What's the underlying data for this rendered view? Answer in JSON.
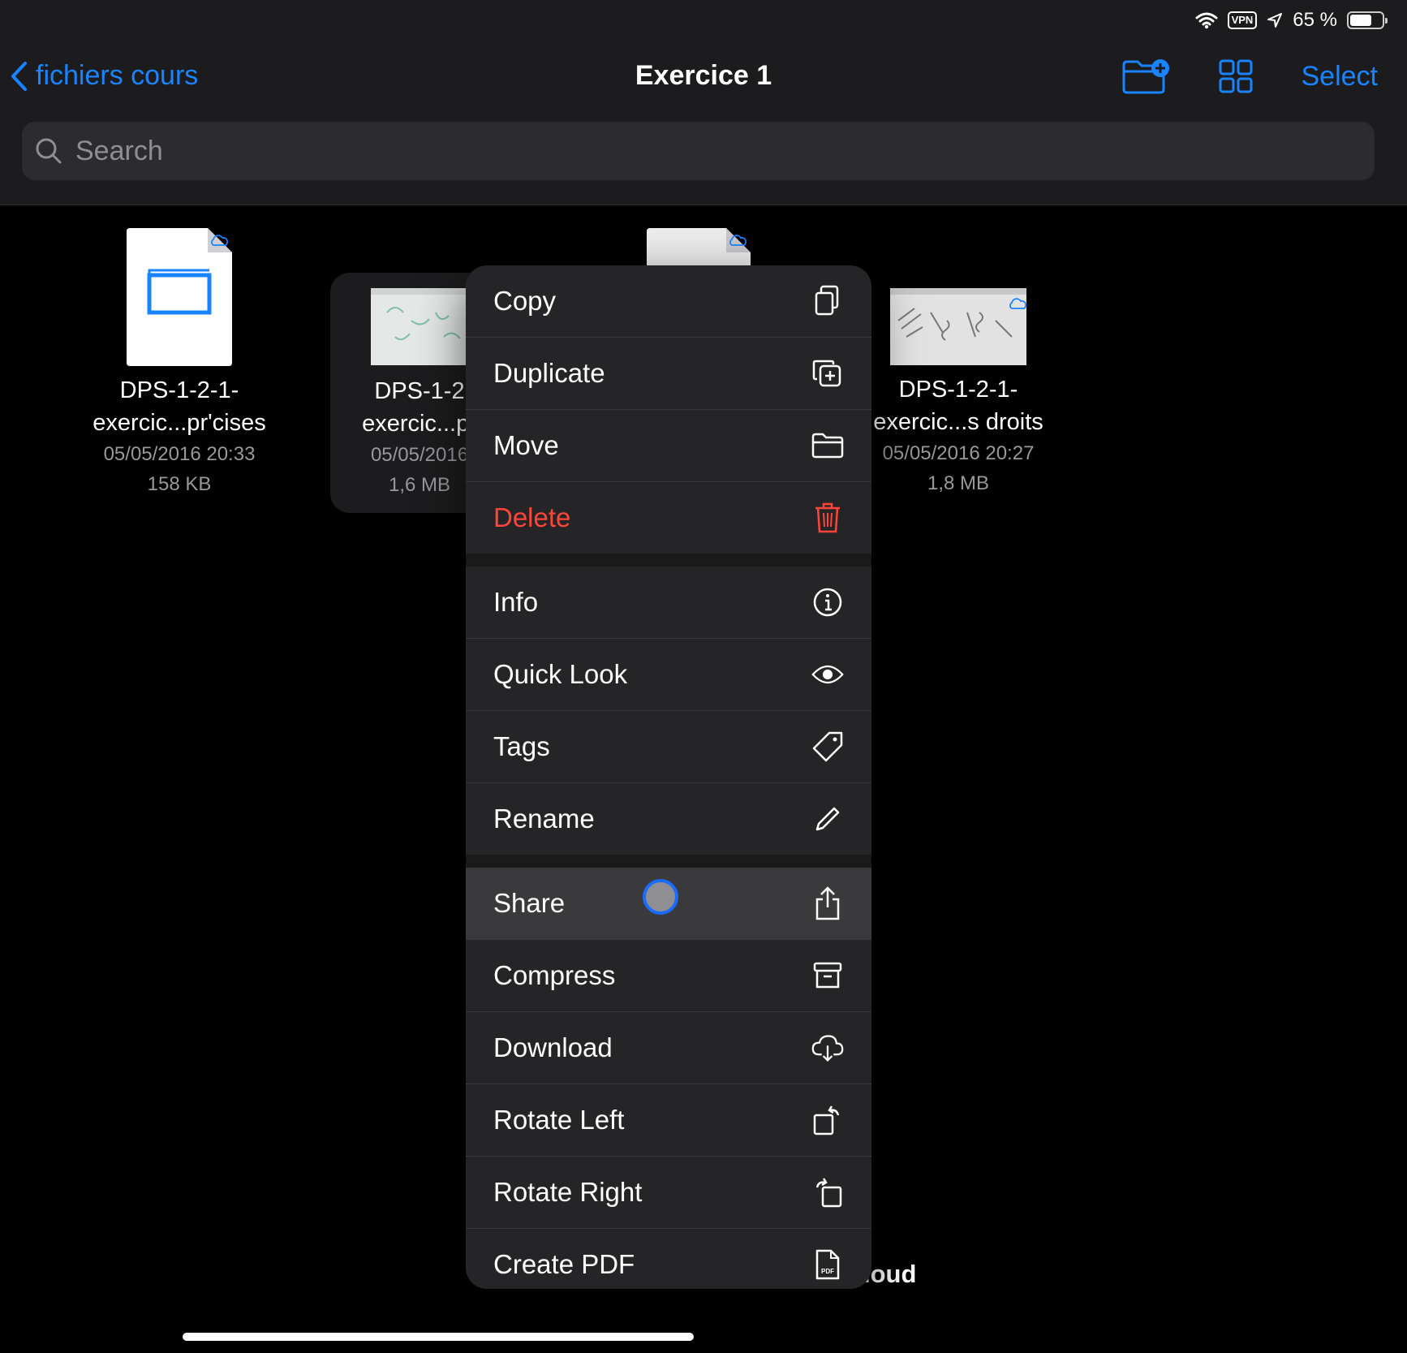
{
  "status": {
    "battery_text": "65 %",
    "vpn": "VPN",
    "battery_level": 0.65
  },
  "nav": {
    "back_label": "fichiers cours",
    "title": "Exercice 1",
    "select_label": "Select"
  },
  "search": {
    "placeholder": "Search"
  },
  "files": [
    {
      "name_line1": "DPS-1-2-1-",
      "name_line2": "exercic...pr'cises",
      "date": "05/05/2016 20:33",
      "size": "158 KB"
    },
    {
      "name_line1": "DPS-1-2",
      "name_line2": "exercic...pr",
      "date": "05/05/2016",
      "size": "1,6 MB"
    },
    {
      "name_line1": "DPS-1-2-1-",
      "name_line2": "exercic...s droits",
      "date": "05/05/2016 20:27",
      "size": "1,8 MB"
    }
  ],
  "menu": {
    "copy": "Copy",
    "duplicate": "Duplicate",
    "move": "Move",
    "delete": "Delete",
    "info": "Info",
    "quick_look": "Quick Look",
    "tags": "Tags",
    "rename": "Rename",
    "share": "Share",
    "compress": "Compress",
    "download": "Download",
    "rotate_left": "Rotate Left",
    "rotate_right": "Rotate Right",
    "create_pdf": "Create PDF"
  },
  "icloud_partial": "loud",
  "colors": {
    "accent": "#1a84ff",
    "destructive": "#ff453a",
    "background": "#000000",
    "bar": "#1c1c1e"
  }
}
